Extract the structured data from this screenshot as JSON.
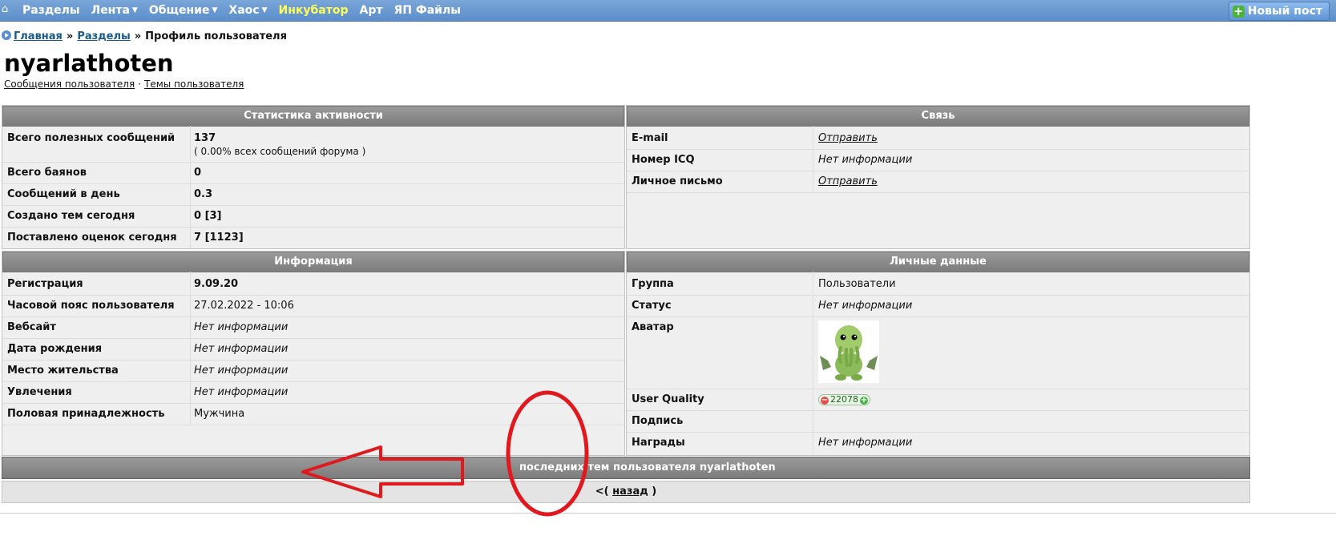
{
  "nav": {
    "items": [
      {
        "label": "Разделы",
        "caret": false,
        "highlight": false
      },
      {
        "label": "Лента",
        "caret": true,
        "highlight": false
      },
      {
        "label": "Общение",
        "caret": true,
        "highlight": false
      },
      {
        "label": "Хаос",
        "caret": true,
        "highlight": false
      },
      {
        "label": "Инкубатор",
        "caret": false,
        "highlight": true
      },
      {
        "label": "Арт",
        "caret": false,
        "highlight": false
      },
      {
        "label": "ЯП Файлы",
        "caret": false,
        "highlight": false
      }
    ],
    "new_post": "Новый пост"
  },
  "breadcrumb": {
    "home": "Главная",
    "sections": "Разделы",
    "current": "Профиль пользователя",
    "sep": "»"
  },
  "profile": {
    "username": "nyarlathoten",
    "links": {
      "posts": "Сообщения пользователя",
      "topics": "Темы пользователя",
      "dot": "·"
    }
  },
  "activity": {
    "title": "Статистика активности",
    "rows": [
      {
        "label": "Всего полезных сообщений",
        "value": "137",
        "sub": "( 0.00% всех сообщений форума )"
      },
      {
        "label": "Всего баянов",
        "value": "0"
      },
      {
        "label": "Сообщений в день",
        "value": "0.3"
      },
      {
        "label": "Создано тем сегодня",
        "value": "0 [3]"
      },
      {
        "label": "Поставлено оценок сегодня",
        "value": "7 [1123]"
      }
    ]
  },
  "contact": {
    "title": "Связь",
    "rows": [
      {
        "label": "E-mail",
        "value": "Отправить",
        "link": true
      },
      {
        "label": "Номер ICQ",
        "value": "Нет информации",
        "link": false
      },
      {
        "label": "Личное письмо",
        "value": "Отправить",
        "link": true
      }
    ]
  },
  "info": {
    "title": "Информация",
    "rows": [
      {
        "label": "Регистрация",
        "value": "9.09.20",
        "style": "bold"
      },
      {
        "label": "Часовой пояс пользователя",
        "value": "27.02.2022 - 10:06",
        "style": "normal"
      },
      {
        "label": "Вебсайт",
        "value": "Нет информации",
        "style": "italic"
      },
      {
        "label": "Дата рождения",
        "value": "Нет информации",
        "style": "italic"
      },
      {
        "label": "Место жительства",
        "value": "Нет информации",
        "style": "italic"
      },
      {
        "label": "Увлечения",
        "value": "Нет информации",
        "style": "italic"
      },
      {
        "label": "Половая принадлежность",
        "value": "Мужчина",
        "style": "normal"
      }
    ]
  },
  "personal": {
    "title": "Личные данные",
    "group_label": "Группа",
    "group_value": "Пользователи",
    "status_label": "Статус",
    "status_value": "Нет информации",
    "avatar_label": "Аватар",
    "uq_label": "User Quality",
    "uq_value": "22078",
    "uq_minus": "−",
    "uq_plus": "+",
    "signature_label": "Подпись",
    "signature_value": "",
    "awards_label": "Награды",
    "awards_value": "Нет информации"
  },
  "last_topics": {
    "title": "последних тем пользователя nyarlathoten"
  },
  "back": {
    "prefix": "<(",
    "link": "назад",
    "suffix": ")"
  },
  "annotation_colors": {
    "ellipse": "#e0191f",
    "arrow": "#e0191f"
  }
}
